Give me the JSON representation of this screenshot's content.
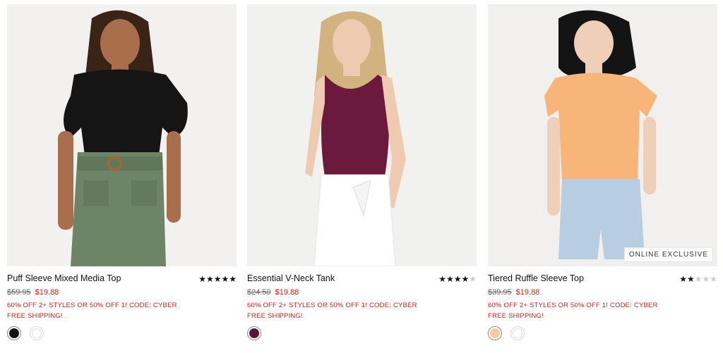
{
  "products": [
    {
      "name": "Puff Sleeve Mixed Media Top",
      "old_price": "$59.95",
      "sale_price": "$19.88",
      "promo": "60% OFF 2+ STYLES OR 50% OFF 1! CODE: CYBER",
      "shipping": "FREE SHIPPING!",
      "rating": 4.5,
      "badge": "",
      "swatches": [
        "#111111",
        "#ffffff"
      ]
    },
    {
      "name": "Essential V-Neck Tank",
      "old_price": "$24.50",
      "sale_price": "$19.88",
      "promo": "60% OFF 2+ STYLES OR 50% OFF 1! CODE: CYBER",
      "shipping": "FREE SHIPPING!",
      "rating": 4.5,
      "badge": "",
      "swatches": [
        "#5a1636"
      ]
    },
    {
      "name": "Tiered Ruffle Sleeve Top",
      "old_price": "$39.95",
      "sale_price": "$19.88",
      "promo": "60% OFF 2+ STYLES OR 50% OFF 1! CODE: CYBER",
      "shipping": "FREE SHIPPING!",
      "rating": 2.5,
      "badge": "ONLINE EXCLUSIVE",
      "swatches": [
        "#f6c9a0",
        "#ffffff"
      ]
    }
  ],
  "colors": {
    "sale_red": "#c0281e",
    "photo_bg": "#f3f2f0"
  }
}
